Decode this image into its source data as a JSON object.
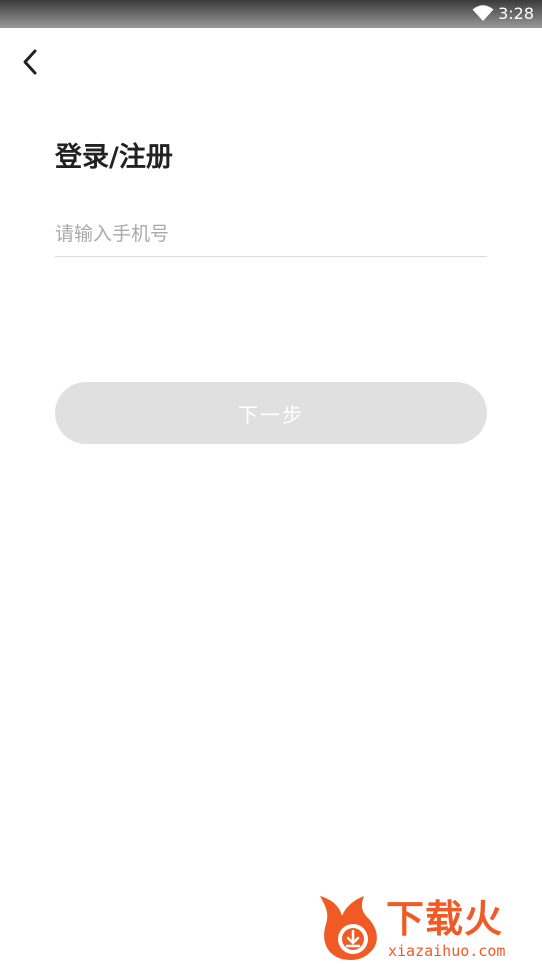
{
  "status_bar": {
    "time": "3:28",
    "wifi_icon": "wifi-icon"
  },
  "nav": {
    "back_icon": "chevron-left-icon"
  },
  "page": {
    "title": "登录/注册"
  },
  "form": {
    "phone_placeholder": "请输入手机号",
    "phone_value": ""
  },
  "actions": {
    "next_label": "下一步"
  },
  "watermark": {
    "brand": "下载火",
    "url": "xiazaihuo.com",
    "accent": "#f15a24"
  }
}
